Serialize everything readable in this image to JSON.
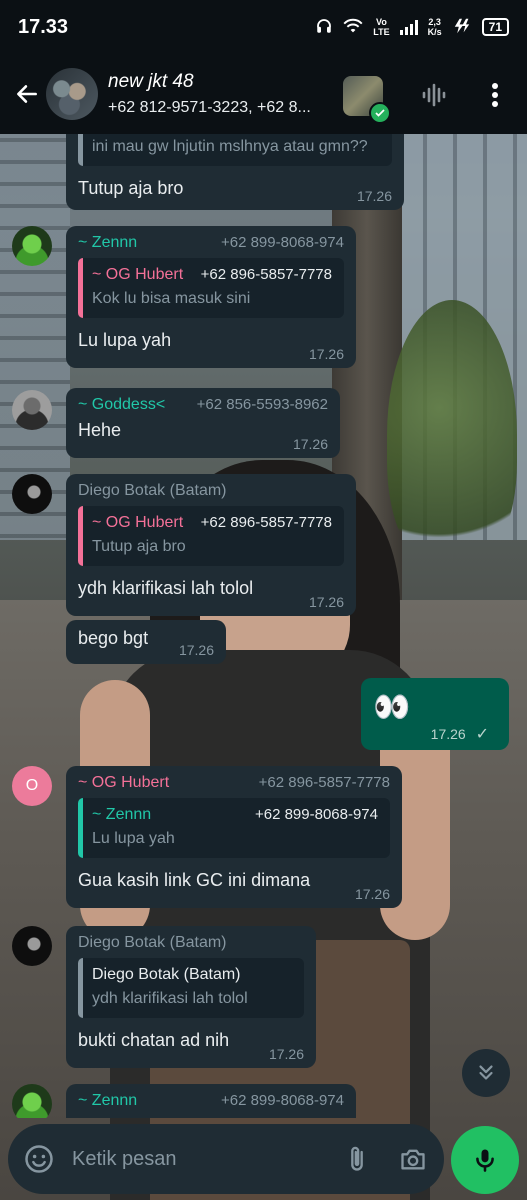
{
  "status_bar": {
    "time": "17.33",
    "network_speed_top": "2,3",
    "network_speed_bottom": "K/s",
    "lte_top": "Vo",
    "lte_bottom": "LTE",
    "battery": "71"
  },
  "header": {
    "title": "new jkt 48",
    "subtitle": "+62 812-9571-3223, +62 8..."
  },
  "messages": [
    {
      "quote_text": "ini mau gw lnjutin mslhnya atau gmn??",
      "text": "Tutup aja bro",
      "time": "17.26"
    },
    {
      "sender": "~ Zennn",
      "phone": "+62 899-8068-974",
      "sender_color": "#21c7a8",
      "quote": {
        "sender": "~ OG Hubert",
        "phone": "+62 896-5857-7778",
        "text": "Kok lu bisa masuk sini",
        "color": "#f47198"
      },
      "text": "Lu lupa yah",
      "time": "17.26"
    },
    {
      "sender": "~ Goddess<",
      "phone": "+62 856-5593-8962",
      "sender_color": "#53bdeb",
      "text": "Hehe",
      "time": "17.26"
    },
    {
      "sender": "Diego Botak (Batam)",
      "sender_color": "#8696a0",
      "quote": {
        "sender": "~ OG Hubert",
        "phone": "+62 896-5857-7778",
        "text": "Tutup aja bro",
        "color": "#f47198"
      },
      "text": "ydh klarifikasi lah tolol",
      "time": "17.26"
    },
    {
      "text": "bego bgt",
      "time": "17.26"
    },
    {
      "outgoing": true,
      "text": "👀",
      "time": "17.26",
      "tick": "✓"
    },
    {
      "sender": "~ OG Hubert",
      "phone": "+62 896-5857-7778",
      "sender_color": "#f47198",
      "avatar_letter": "O",
      "quote": {
        "sender": "~ Zennn",
        "phone": "+62 899-8068-974",
        "text": "Lu lupa yah",
        "color": "#21c7a8"
      },
      "text": "Gua kasih link GC ini dimana",
      "time": "17.26"
    },
    {
      "sender": "Diego Botak (Batam)",
      "sender_color": "#8696a0",
      "quote": {
        "sender": "Diego Botak (Batam)",
        "text": "ydh klarifikasi lah tolol",
        "color": "#8696a0"
      },
      "text": "bukti chatan ad nih",
      "time": "17.26"
    },
    {
      "sender": "~ Zennn",
      "phone": "+62 899-8068-974",
      "sender_color": "#21c7a8"
    }
  ],
  "composer": {
    "placeholder": "Ketik pesan"
  },
  "icons": {
    "back": "arrow-left-icon",
    "voice_call": "audio-wave-icon",
    "menu": "more-vert-icon",
    "emoji": "emoji-icon",
    "attach": "paperclip-icon",
    "camera": "camera-icon",
    "mic": "mic-icon",
    "scroll_down": "double-chevron-down-icon"
  }
}
